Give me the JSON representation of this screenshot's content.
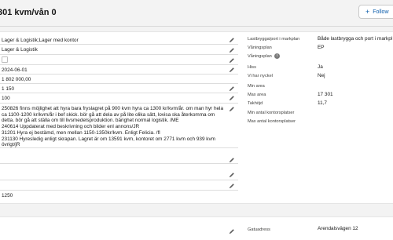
{
  "header": {
    "title": "301 kvm/vån 0",
    "follow_label": "Follow"
  },
  "left_fields": {
    "f1": "Lager & Logistik;Lager med kontor",
    "f2": "Lager & Logistik",
    "f4": "2024-06-01",
    "f5": "1 802 000,00",
    "f6": "1 150",
    "f7": "100",
    "notes": [
      "250826 finns möjlighet att hyra bara fryslagret på 900 kvm hyra ca 1300 kr/kvm/år. om man hyr hela",
      "ca 1100-1200 kr/kvm/år i bef skick. bör gå att dela av på lite olika sätt, lovisa ska återkomma om",
      "detta. bör gå att ställa om till livsmedelsproduktion. bärighet normal logistik. /ME",
      "240614 Uppdaterat med beskrivning och bilder enl annons/JR",
      "31201 Hyra ej bestämd, men mellan 1150-1350kr/kvm. Enligt Felicia. /fl",
      "231130 Hyresledig enligt skrapan. Lagret är om 13591 kvm, kontoret om 2771 kvm och 939 kvm",
      "övrigt/jR"
    ],
    "f_last": "1250"
  },
  "right_fields": [
    {
      "label": "Lastbrygga/port i markplan",
      "value": "Både lastbrygga och port i markpl"
    },
    {
      "label": "Våningsplan",
      "value": "EP"
    },
    {
      "label": "Våningsplan",
      "value": ""
    },
    {
      "label": "Hiss",
      "value": "Ja"
    },
    {
      "label": "Vi har nyckel",
      "value": "Nej"
    },
    {
      "label": "Min area",
      "value": ""
    },
    {
      "label": "Max area",
      "value": "17 301"
    },
    {
      "label": "Takhöjd",
      "value": "11,7"
    },
    {
      "label": "Min antal kontorsplatser",
      "value": ""
    },
    {
      "label": "Max antal kontorsplatser",
      "value": ""
    }
  ],
  "address": {
    "label": "Gatuadress",
    "value": "Arendalsvägen 12"
  },
  "colors": {
    "accent": "#0b5cab",
    "page_bg": "#f3f3f3",
    "card_bg": "#ffffff"
  }
}
